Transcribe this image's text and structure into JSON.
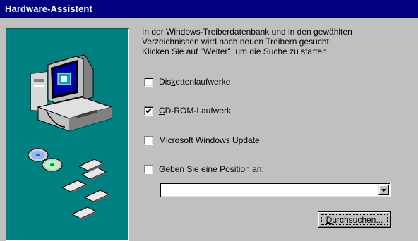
{
  "window": {
    "title": "Hardware-Assistent"
  },
  "description": {
    "lines": [
      "In der Windows-Treiberdatenbank und in den gewählten",
      "Verzeichnissen wird nach neuen Treibern gesucht.",
      "Klicken Sie auf \"Weiter\", um die Suche zu starten."
    ]
  },
  "options": [
    {
      "pre": "Dis",
      "key": "k",
      "post": "ettenlaufwerke",
      "checked": false
    },
    {
      "pre": "",
      "key": "C",
      "post": "D-ROM-Laufwerk",
      "checked": true
    },
    {
      "pre": "",
      "key": "M",
      "post": "icrosoft Windows Update",
      "checked": false
    },
    {
      "pre": "",
      "key": "G",
      "post": "eben Sie eine Position an:",
      "checked": false
    }
  ],
  "location": {
    "value": ""
  },
  "browse": {
    "pre": "",
    "key": "D",
    "post": "urchsuchen..."
  },
  "colors": {
    "titlebar": "#000080",
    "panel": "#008080",
    "face": "#c0c0c0"
  },
  "icons": [
    "computer-icon",
    "cd-disc-icon",
    "floppy-disk-icon",
    "chevron-down-icon",
    "checkmark-icon"
  ]
}
